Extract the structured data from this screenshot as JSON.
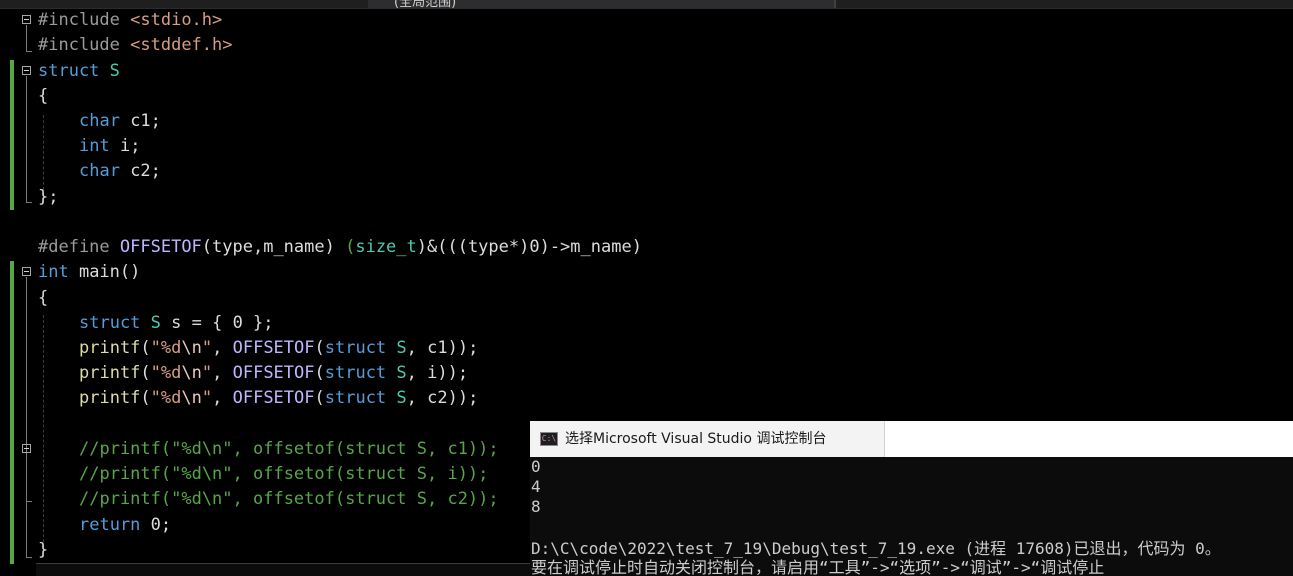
{
  "top_tab_fragment": "(全局范围)",
  "code": {
    "line1": {
      "pp": "#include",
      "header": "<stdio.h>"
    },
    "line2": {
      "pp": "#include",
      "header": "<stddef.h>"
    },
    "line3": {
      "kw": "struct",
      "name": "S"
    },
    "line4": "{",
    "line5": {
      "kw": "char",
      "rest": " c1;"
    },
    "line6": {
      "kw": "int",
      "rest": " i;"
    },
    "line7": {
      "kw": "char",
      "rest": " c2;"
    },
    "line8": "};",
    "line10": {
      "pp": "#define",
      "macro": "OFFSETOF",
      "params": "(type,m_name) ",
      "cast_open": "(",
      "cast_type": "size_t",
      "cast_rest": ")&(((type*)0)->m_name)"
    },
    "line11": {
      "kw": "int",
      "rest": " main()"
    },
    "line12": "{",
    "line13": {
      "kw": "struct",
      "type": "S",
      "rest": " s = { 0 };"
    },
    "line14": {
      "fn": "printf",
      "open": "(",
      "str1": "\"%d",
      "esc": "\\n",
      "str2": "\"",
      "comma": ", ",
      "macro": "OFFSETOF",
      "popen": "(",
      "kw": "struct",
      "type": " S",
      "arg": ", c1));"
    },
    "line15": {
      "fn": "printf",
      "open": "(",
      "str1": "\"%d",
      "esc": "\\n",
      "str2": "\"",
      "comma": ", ",
      "macro": "OFFSETOF",
      "popen": "(",
      "kw": "struct",
      "type": " S",
      "arg": ", i));"
    },
    "line16": {
      "fn": "printf",
      "open": "(",
      "str1": "\"%d",
      "esc": "\\n",
      "str2": "\"",
      "comma": ", ",
      "macro": "OFFSETOF",
      "popen": "(",
      "kw": "struct",
      "type": " S",
      "arg": ", c2));"
    },
    "line18": "//printf(\"%d\\n\", offsetof(struct S, c1));",
    "line19": "//printf(\"%d\\n\", offsetof(struct S, i));",
    "line20": "//printf(\"%d\\n\", offsetof(struct S, c2));",
    "line21": {
      "kw": "return",
      "rest": " 0;"
    },
    "line22": "}"
  },
  "console": {
    "icon_text": "C:\\",
    "title": "选择Microsoft Visual Studio 调试控制台",
    "output": [
      "0",
      "4",
      "8",
      "",
      "D:\\C\\code\\2022\\test_7_19\\Debug\\test_7_19.exe (进程 17608)已退出，代码为 0。",
      "要在调试停止时自动关闭控制台，请启用“工具”->“选项”->“调试”->“调试停止"
    ]
  }
}
